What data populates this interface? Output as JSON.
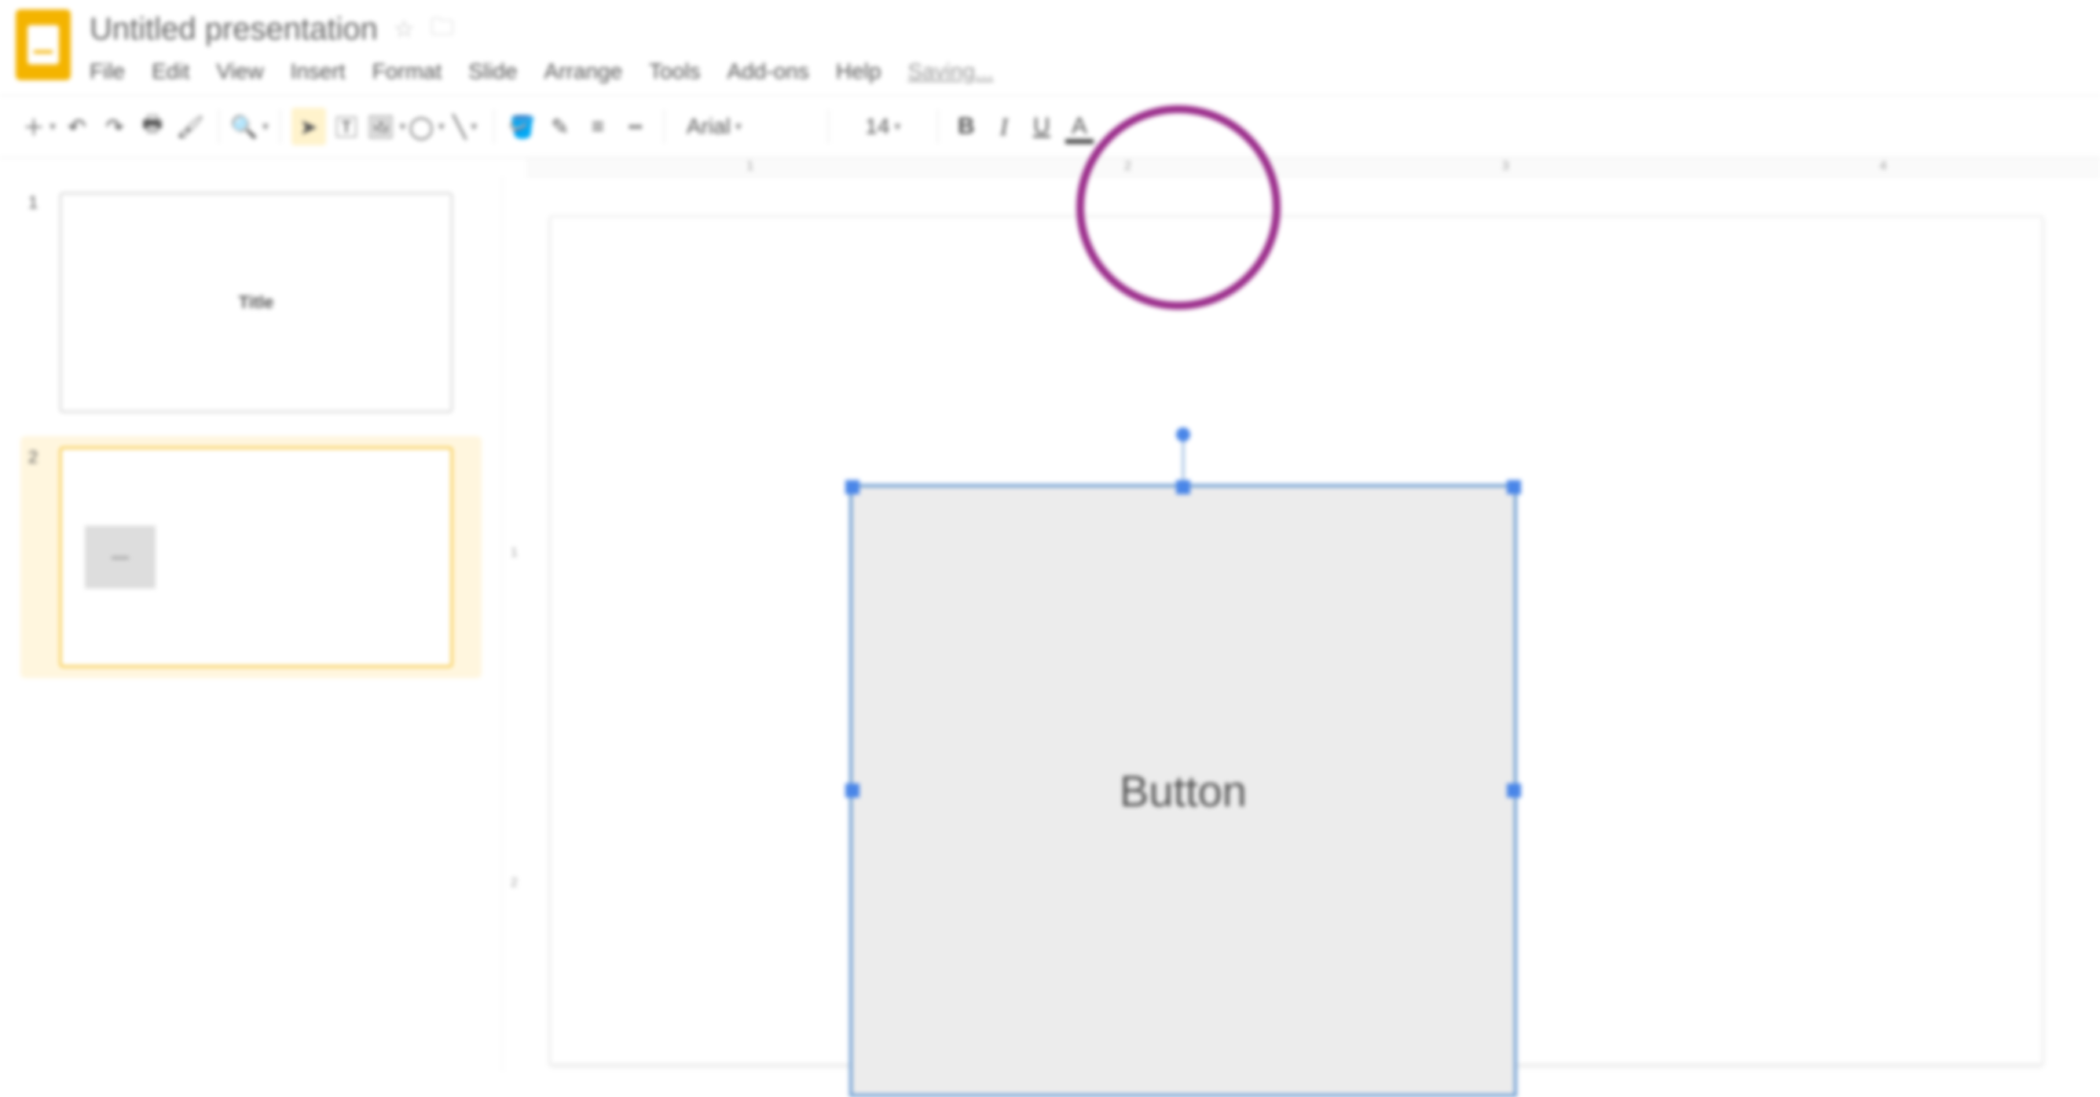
{
  "header": {
    "doc_title": "Untitled presentation",
    "saving_text": "Saving..."
  },
  "menu": {
    "file": "File",
    "edit": "Edit",
    "view": "View",
    "insert": "Insert",
    "format": "Format",
    "slide": "Slide",
    "arrange": "Arrange",
    "tools": "Tools",
    "addons": "Add-ons",
    "help": "Help"
  },
  "toolbar": {
    "font_name": "Arial",
    "font_size": "14"
  },
  "ruler": {
    "ticks": [
      "1",
      "2",
      "3",
      "4"
    ]
  },
  "vruler": {
    "ticks": [
      "1",
      "2"
    ]
  },
  "sidebar": {
    "slides": [
      {
        "num": "1",
        "label": "Title"
      },
      {
        "num": "2",
        "label": ""
      }
    ]
  },
  "canvas": {
    "shape_text": "Button"
  }
}
